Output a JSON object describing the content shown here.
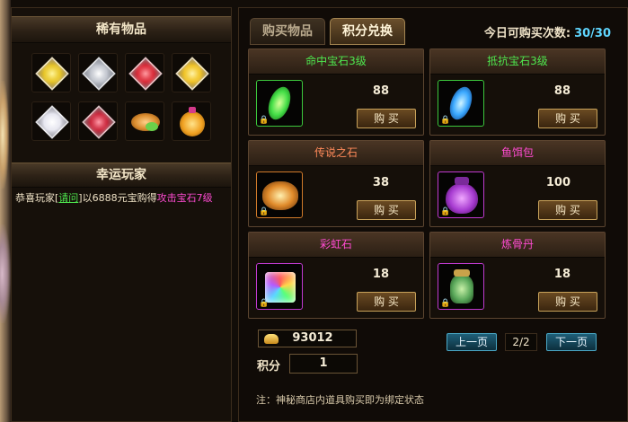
{
  "left": {
    "rare_title": "稀有物品",
    "rare_items": [
      {
        "icon": "yellow-gem-icon",
        "color": "#e6c21c"
      },
      {
        "icon": "silver-gem-icon",
        "color": "#bfc3cc"
      },
      {
        "icon": "red-gem-icon",
        "color": "#d8202e"
      },
      {
        "icon": "gold-gem-icon",
        "color": "#f0c01a"
      },
      {
        "icon": "white-gem-icon",
        "color": "#e6e6f0"
      },
      {
        "icon": "crimson-gem-icon",
        "color": "#c81e34"
      },
      {
        "icon": "food-bait-icon",
        "color": "#d88a2c"
      },
      {
        "icon": "pumpkin-pot-icon",
        "color": "#f0a020"
      }
    ],
    "lucky_title": "幸运玩家",
    "lucky": {
      "prefix": "恭喜玩家[",
      "player": "请问",
      "middle": "]以6888元宝购得",
      "item": "攻击宝石7级"
    }
  },
  "tabs": {
    "buy_items": "购买物品",
    "points_exchange": "积分兑换"
  },
  "daily": {
    "label": "今日可购买次数:",
    "value": "30/30"
  },
  "items": [
    {
      "name": "命中宝石3级",
      "price": "88",
      "buy": "购 买",
      "name_color": "green",
      "icon": "green-gem-icon",
      "icon_color": "#46e048"
    },
    {
      "name": "抵抗宝石3级",
      "price": "88",
      "buy": "购 买",
      "name_color": "green",
      "icon": "blue-gem-icon",
      "icon_color": "#3aa8ff"
    },
    {
      "name": "传说之石",
      "price": "38",
      "buy": "购 买",
      "name_color": "orange",
      "icon": "legend-stone-icon",
      "icon_color": "#e08a2a"
    },
    {
      "name": "鱼饵包",
      "price": "100",
      "buy": "购 买",
      "name_color": "pink",
      "icon": "bait-bag-icon",
      "icon_color": "#a63ad0"
    },
    {
      "name": "彩虹石",
      "price": "18",
      "buy": "购 买",
      "name_color": "pink",
      "icon": "rainbow-stone-icon",
      "icon_color": "#7ee8c8"
    },
    {
      "name": "炼骨丹",
      "price": "18",
      "buy": "购 买",
      "name_color": "pink",
      "icon": "bone-pill-jar-icon",
      "icon_color": "#5aa85a"
    }
  ],
  "gold": "93012",
  "score": {
    "label": "积分",
    "value": "1"
  },
  "pager": {
    "prev": "上一页",
    "indicator": "2/2",
    "next": "下一页"
  },
  "note": "注：神秘商店内道具购买即为绑定状态"
}
